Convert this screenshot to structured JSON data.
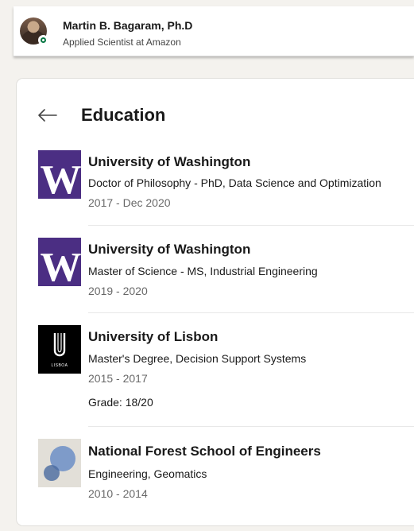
{
  "profile": {
    "name": "Martin B. Bagaram, Ph.D",
    "headline": "Applied Scientist at Amazon",
    "status": "online",
    "status_color": "#057642"
  },
  "section": {
    "title": "Education",
    "back_icon": "arrow-left-icon"
  },
  "education": [
    {
      "school": "University of Washington",
      "degree": "Doctor of Philosophy - PhD, Data Science and Optimization",
      "dates": "2017 - Dec 2020",
      "logo": "W",
      "logo_color": "#4b2e83"
    },
    {
      "school": "University of Washington",
      "degree": "Master of Science - MS, Industrial Engineering",
      "dates": "2019 - 2020",
      "logo": "W",
      "logo_color": "#4b2e83"
    },
    {
      "school": "University of Lisbon",
      "degree": "Master's Degree, Decision Support Systems",
      "dates": "2015 - 2017",
      "grade": "Grade: 18/20",
      "logo": "U",
      "logo_caption": "LISBOA",
      "logo_color": "#000000"
    },
    {
      "school": "National Forest School of Engineers",
      "degree": "Engineering, Geomatics",
      "dates": "2010 - 2014",
      "logo_color": "#e2dfd8"
    }
  ]
}
